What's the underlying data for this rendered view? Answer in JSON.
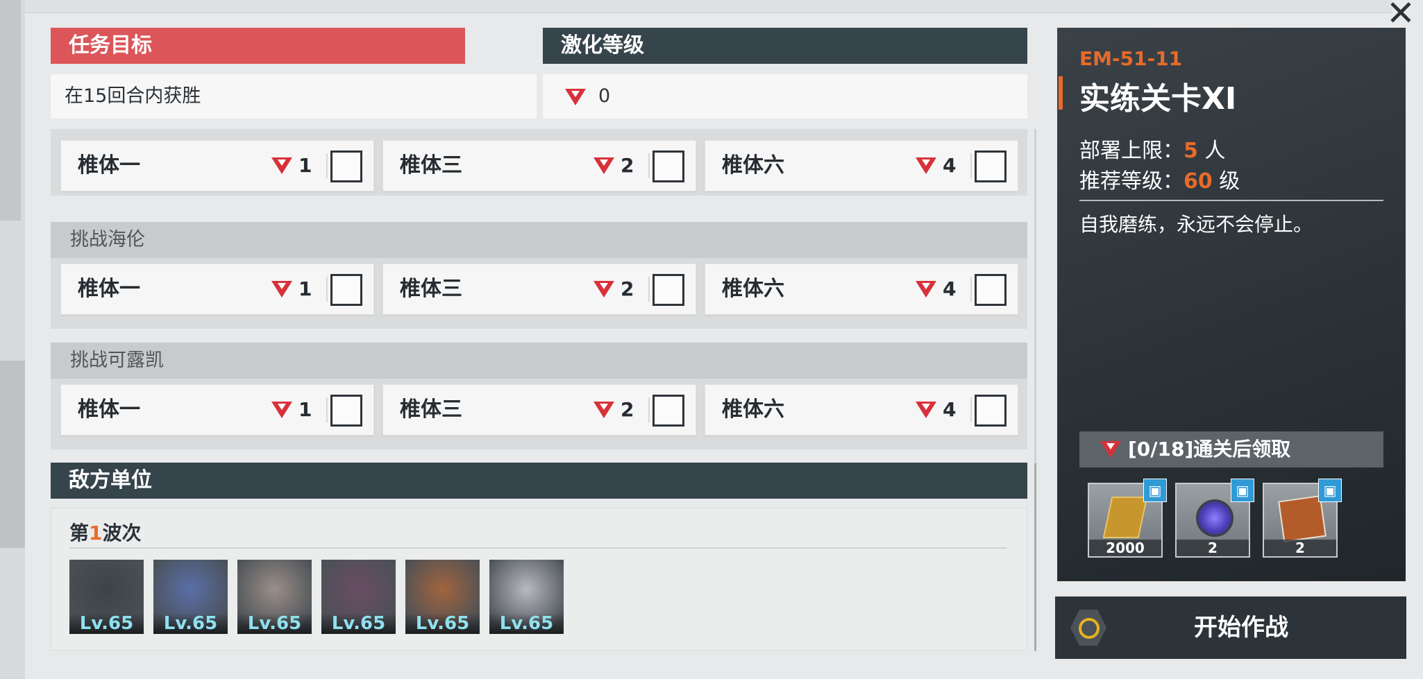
{
  "close_icon": "close-icon",
  "objective": {
    "header": "任务目标",
    "condition": "在15回合内获胜"
  },
  "intensity": {
    "header": "激化等级",
    "value": "0"
  },
  "challenges": [
    {
      "title": "",
      "options": [
        {
          "label": "椎体一",
          "value": "1"
        },
        {
          "label": "椎体三",
          "value": "2"
        },
        {
          "label": "椎体六",
          "value": "4"
        }
      ]
    },
    {
      "title": "挑战海伦",
      "options": [
        {
          "label": "椎体一",
          "value": "1"
        },
        {
          "label": "椎体三",
          "value": "2"
        },
        {
          "label": "椎体六",
          "value": "4"
        }
      ]
    },
    {
      "title": "挑战可露凯",
      "options": [
        {
          "label": "椎体一",
          "value": "1"
        },
        {
          "label": "椎体三",
          "value": "2"
        },
        {
          "label": "椎体六",
          "value": "4"
        }
      ]
    }
  ],
  "enemy": {
    "header": "敌方单位",
    "wave_prefix": "第",
    "wave_number": "1",
    "wave_suffix": "波次",
    "units": [
      {
        "level": "Lv.65",
        "color": "#3e4348"
      },
      {
        "level": "Lv.65",
        "color": "#5a6fa8"
      },
      {
        "level": "Lv.65",
        "color": "#9b8f88"
      },
      {
        "level": "Lv.65",
        "color": "#6a4d64"
      },
      {
        "level": "Lv.65",
        "color": "#a2643e"
      },
      {
        "level": "Lv.65",
        "color": "#b9b9c2"
      }
    ]
  },
  "stage": {
    "code": "EM-51-11",
    "title": "实练关卡XI",
    "deploy_label": "部署上限：",
    "deploy_value": "5",
    "deploy_unit": " 人",
    "level_label": "推荐等级：",
    "level_value": "60",
    "level_unit": " 级",
    "description": "自我磨练，永远不会停止。",
    "reward_banner": "[0/18]通关后领取",
    "rewards": [
      {
        "count": "2000",
        "icon": "gold-bar-icon",
        "color": "#c7972d"
      },
      {
        "count": "2",
        "icon": "crystal-core-icon",
        "color": "#5b4fc6"
      },
      {
        "count": "2",
        "icon": "data-card-icon",
        "color": "#b45b2a"
      }
    ]
  },
  "start_button": {
    "label": "开始作战"
  },
  "colors": {
    "accent_orange": "#e86b2a",
    "objective_red": "#dc5559",
    "header_dark": "#36444c",
    "triangle_red": "#d8313a"
  }
}
